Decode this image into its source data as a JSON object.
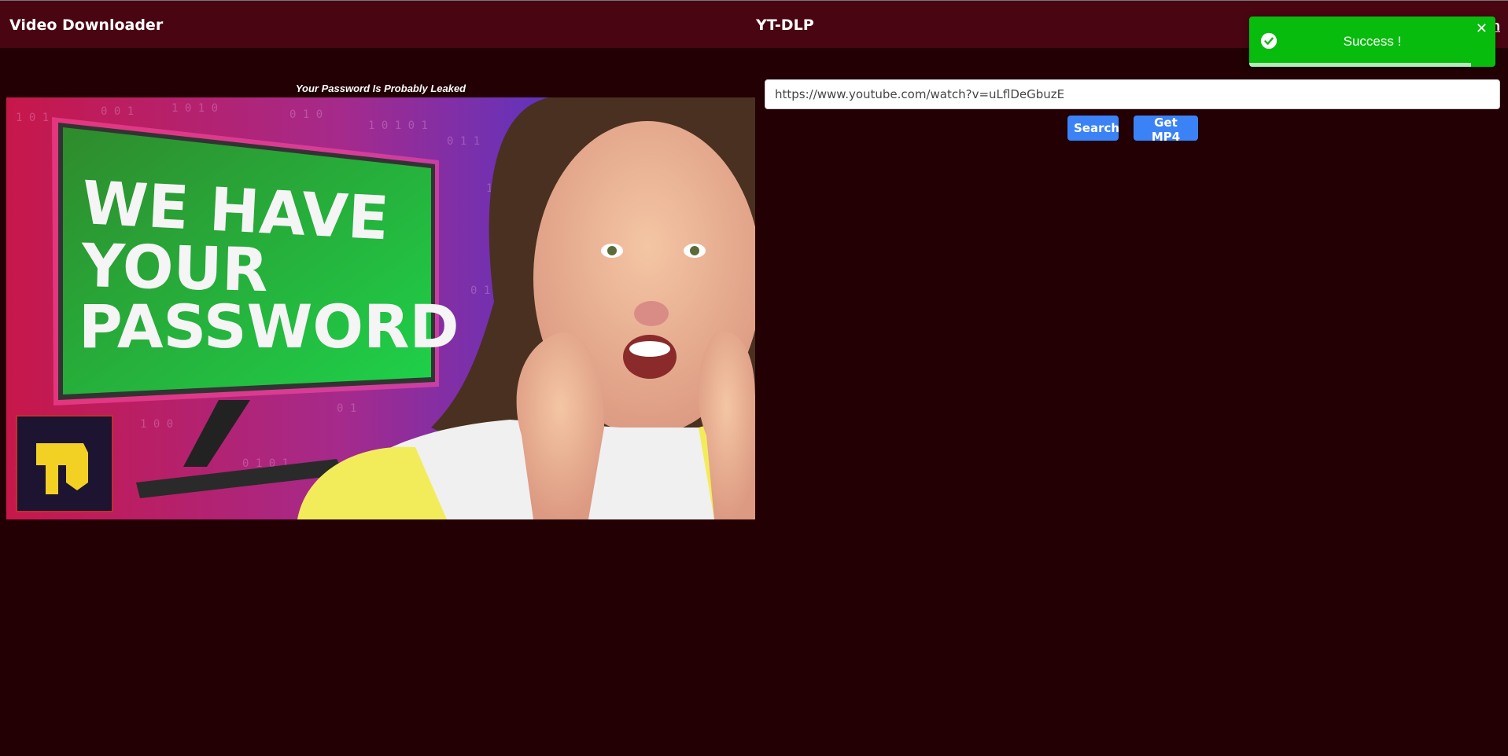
{
  "navbar": {
    "brand": "Video Downloader",
    "title": "YT-DLP",
    "right_link": "n"
  },
  "video": {
    "title": "Your Password Is Probably Leaked",
    "thumbnail": {
      "headline_line1": "WE HAVE",
      "headline_line2": "YOUR",
      "headline_line3": "PASSWORD",
      "logo": "channel-logo"
    }
  },
  "search": {
    "url_value": "https://www.youtube.com/watch?v=uLflDeGbuzE",
    "search_label": "Search",
    "mp4_label": "Get MP4"
  },
  "toast": {
    "message": "Success !",
    "close_glyph": "✕",
    "progress": 0.9
  },
  "colors": {
    "background": "#220003",
    "navbar": "#4a0512",
    "button": "#3b82f6",
    "toast": "#07bc0c"
  }
}
